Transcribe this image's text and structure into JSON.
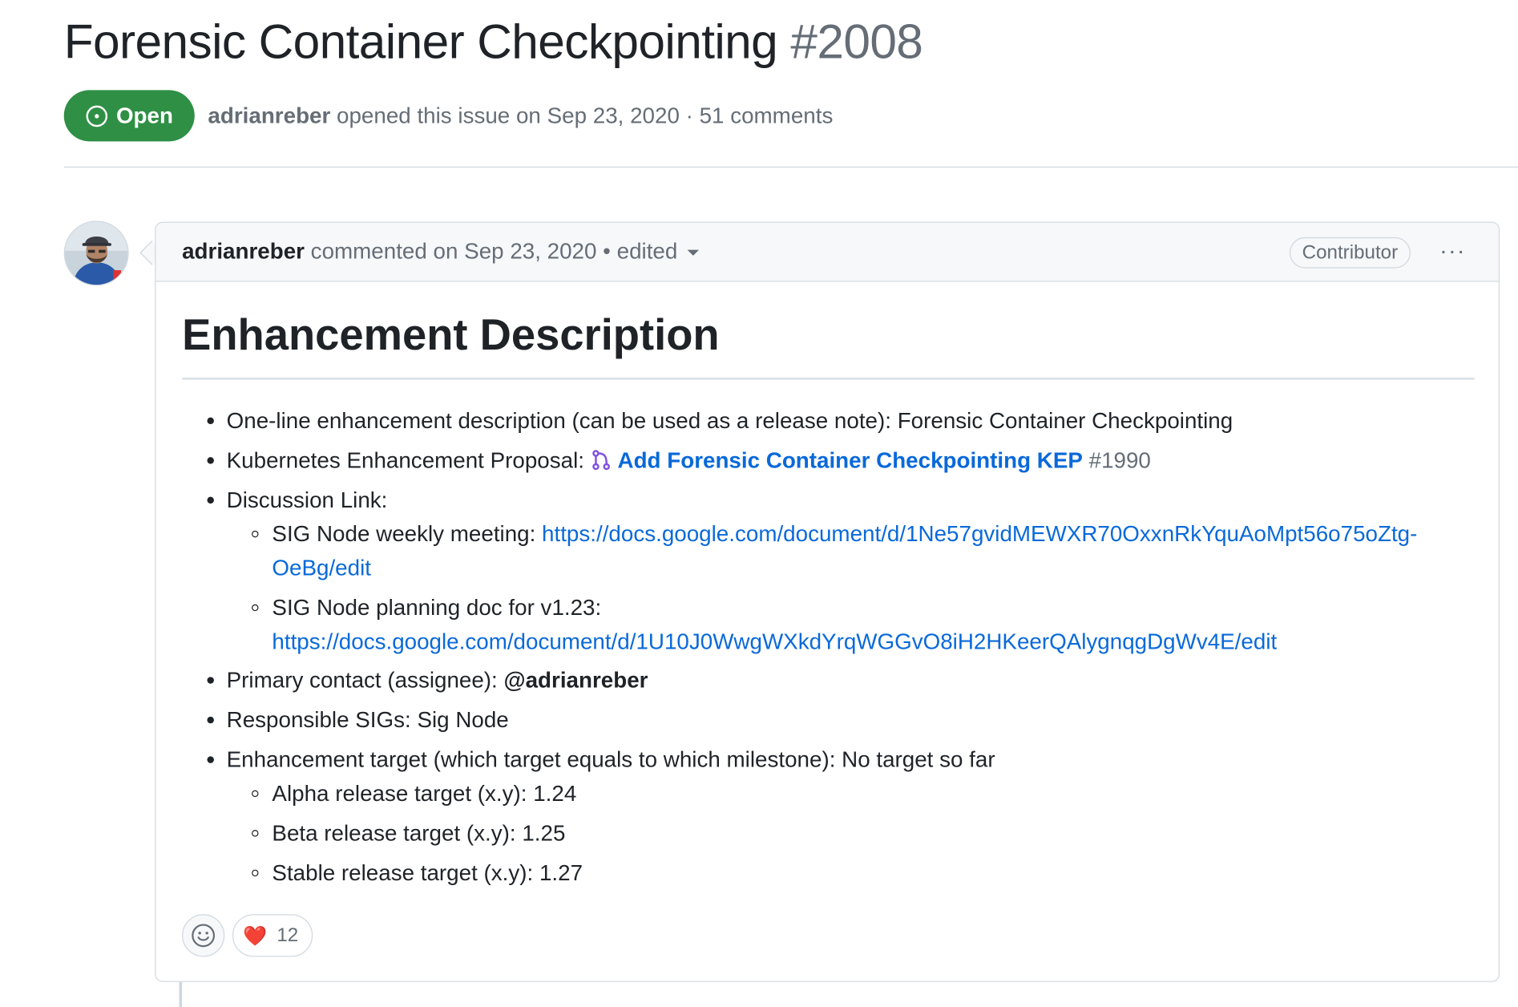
{
  "issue": {
    "title": "Forensic Container Checkpointing",
    "number": "#2008",
    "state": "Open",
    "author": "adrianreber",
    "meta": "opened this issue on Sep 23, 2020 · 51 comments"
  },
  "comment": {
    "author": "adrianreber",
    "meta": "commented on Sep 23, 2020",
    "edited": "• edited",
    "role": "Contributor",
    "more": "···",
    "heading": "Enhancement Description",
    "items": {
      "one_line_label": "One-line enhancement description (can be used as a release note): Forensic Container Checkpointing",
      "kep_label": "Kubernetes Enhancement Proposal: ",
      "kep_pr_title": "Add Forensic Container Checkpointing KEP",
      "kep_pr_number": "#1990",
      "discussion_label": "Discussion Link:",
      "weekly_label": "SIG Node weekly meeting: ",
      "weekly_link_1": "https://docs.google.com/document/d/1Ne57gvidMEWXR70OxxnRkYquAoMpt56o75oZtg-",
      "weekly_link_2": "OeBg/edit",
      "planning_label": "SIG Node planning doc for v1.23:",
      "planning_link": "https://docs.google.com/document/d/1U10J0WwgWXkdYrqWGGvO8iH2HKeerQAlygnqgDgWv4E/edit",
      "contact_label": "Primary contact (assignee): ",
      "contact_user": "@adrianreber",
      "sigs_label": "Responsible SIGs: Sig Node",
      "target_label": "Enhancement target (which target equals to which milestone): No target so far",
      "alpha": "Alpha release target (x.y): 1.24",
      "beta": "Beta release target (x.y): 1.25",
      "stable": "Stable release target (x.y): 1.27"
    },
    "reactions": {
      "heart_count": "12"
    }
  },
  "colors": {
    "open_green": "#2f8f45",
    "link_blue": "#0969da",
    "muted": "#656d76",
    "pr_purple": "#8250df"
  },
  "icons": [
    "issue-opened-icon",
    "avatar",
    "git-pull-request-icon",
    "smiley-icon",
    "heart-icon",
    "kebab-icon",
    "caret-down-icon"
  ]
}
